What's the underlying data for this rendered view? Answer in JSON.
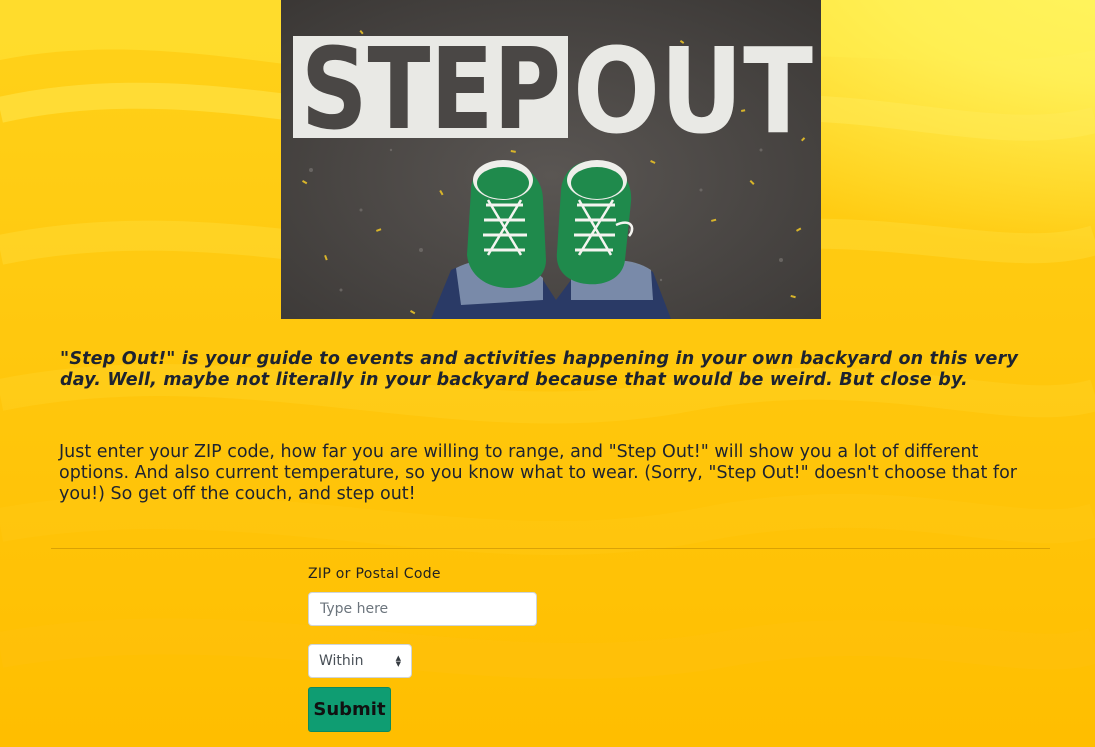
{
  "hero": {
    "sign_text_left": "STEP",
    "sign_text_right": "OUT"
  },
  "intro": {
    "tagline": "\"Step Out!\" is your guide to events and activities happening in your own backyard on this very day. Well, maybe not literally in your backyard because that would be weird. But close by.",
    "description": "Just enter your ZIP code, how far you are willing to range, and \"Step Out!\" will show you a lot of different options. And also current temperature, so you know what to wear. (Sorry, \"Step Out!\" doesn't choose that for you!) So get off the couch, and step out!"
  },
  "form": {
    "zip_label": "ZIP or Postal Code",
    "zip_placeholder": "Type here",
    "zip_value": "",
    "range_select_value": "Within",
    "submit_label": "Submit"
  },
  "colors": {
    "background_primary": "#ffc80e",
    "background_highlight": "#fff86a",
    "text": "#1d2330",
    "submit_button": "#0f9d72",
    "sneaker_green": "#1f8a4c"
  }
}
